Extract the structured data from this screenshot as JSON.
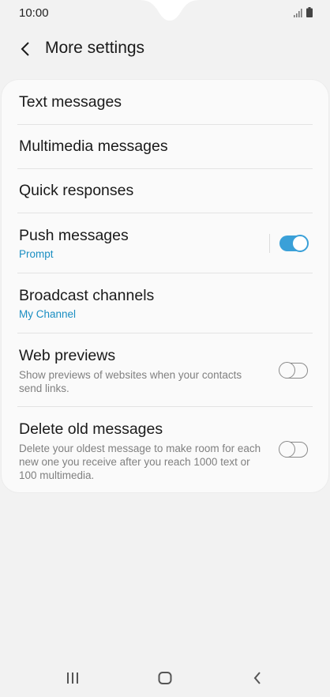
{
  "status_bar": {
    "time": "10:00"
  },
  "header": {
    "title": "More settings",
    "back_icon": "chevron-left-icon"
  },
  "settings": {
    "text_messages": {
      "title": "Text messages"
    },
    "multimedia_messages": {
      "title": "Multimedia messages"
    },
    "quick_responses": {
      "title": "Quick responses"
    },
    "push_messages": {
      "title": "Push messages",
      "value": "Prompt",
      "toggle_on": true
    },
    "broadcast_channels": {
      "title": "Broadcast channels",
      "value": "My Channel"
    },
    "web_previews": {
      "title": "Web previews",
      "description": "Show previews of websites when your contacts send links.",
      "toggle_on": false
    },
    "delete_old_messages": {
      "title": "Delete old messages",
      "description": "Delete your oldest message to make room for each new one you receive after you reach 1000 text or 100 multimedia.",
      "toggle_on": false
    }
  },
  "nav_bar": {
    "recents_icon": "recents-icon",
    "home_icon": "home-icon",
    "back_icon": "back-icon"
  },
  "colors": {
    "accent": "#3aa0d8",
    "link": "#1a8ec2",
    "background": "#f2f2f2",
    "card": "#fafafa"
  }
}
